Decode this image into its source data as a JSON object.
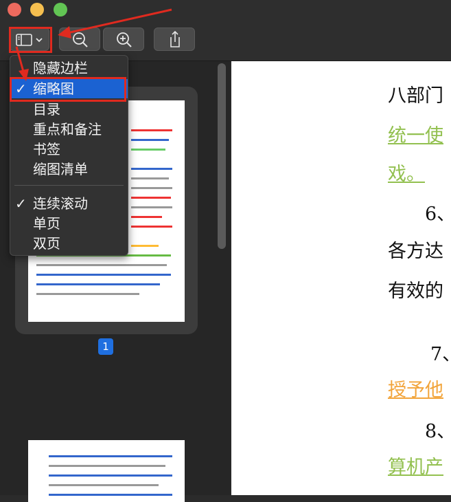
{
  "toolbar": {
    "sidebar_icon": "sidebar-icon",
    "zoom_out_icon": "zoom-out-icon",
    "zoom_in_icon": "zoom-in-icon",
    "share_icon": "share-icon"
  },
  "menu": {
    "items": [
      {
        "label": "隐藏边栏",
        "checked": false,
        "selected": false
      },
      {
        "label": "缩略图",
        "checked": true,
        "selected": true
      },
      {
        "label": "目录",
        "checked": false,
        "selected": false
      },
      {
        "label": "重点和备注",
        "checked": false,
        "selected": false
      },
      {
        "label": "书签",
        "checked": false,
        "selected": false
      },
      {
        "label": "缩图清单",
        "checked": false,
        "selected": false
      },
      {
        "label": "连续滚动",
        "checked": true,
        "selected": false
      },
      {
        "label": "单页",
        "checked": false,
        "selected": false
      },
      {
        "label": "双页",
        "checked": false,
        "selected": false
      }
    ],
    "check_glyph": "✓"
  },
  "sidebar": {
    "page_number": "1"
  },
  "document": {
    "lines": [
      "八部门",
      "统一使",
      "戏。",
      "6、",
      "各方达",
      "有效的",
      "7、",
      "授予他",
      "8、",
      "算机产"
    ]
  },
  "colors": {
    "selected": "#1b62d2",
    "annotation_red": "#e02a1f",
    "highlight_green": "#92c04f",
    "highlight_orange": "#f2a43a"
  }
}
